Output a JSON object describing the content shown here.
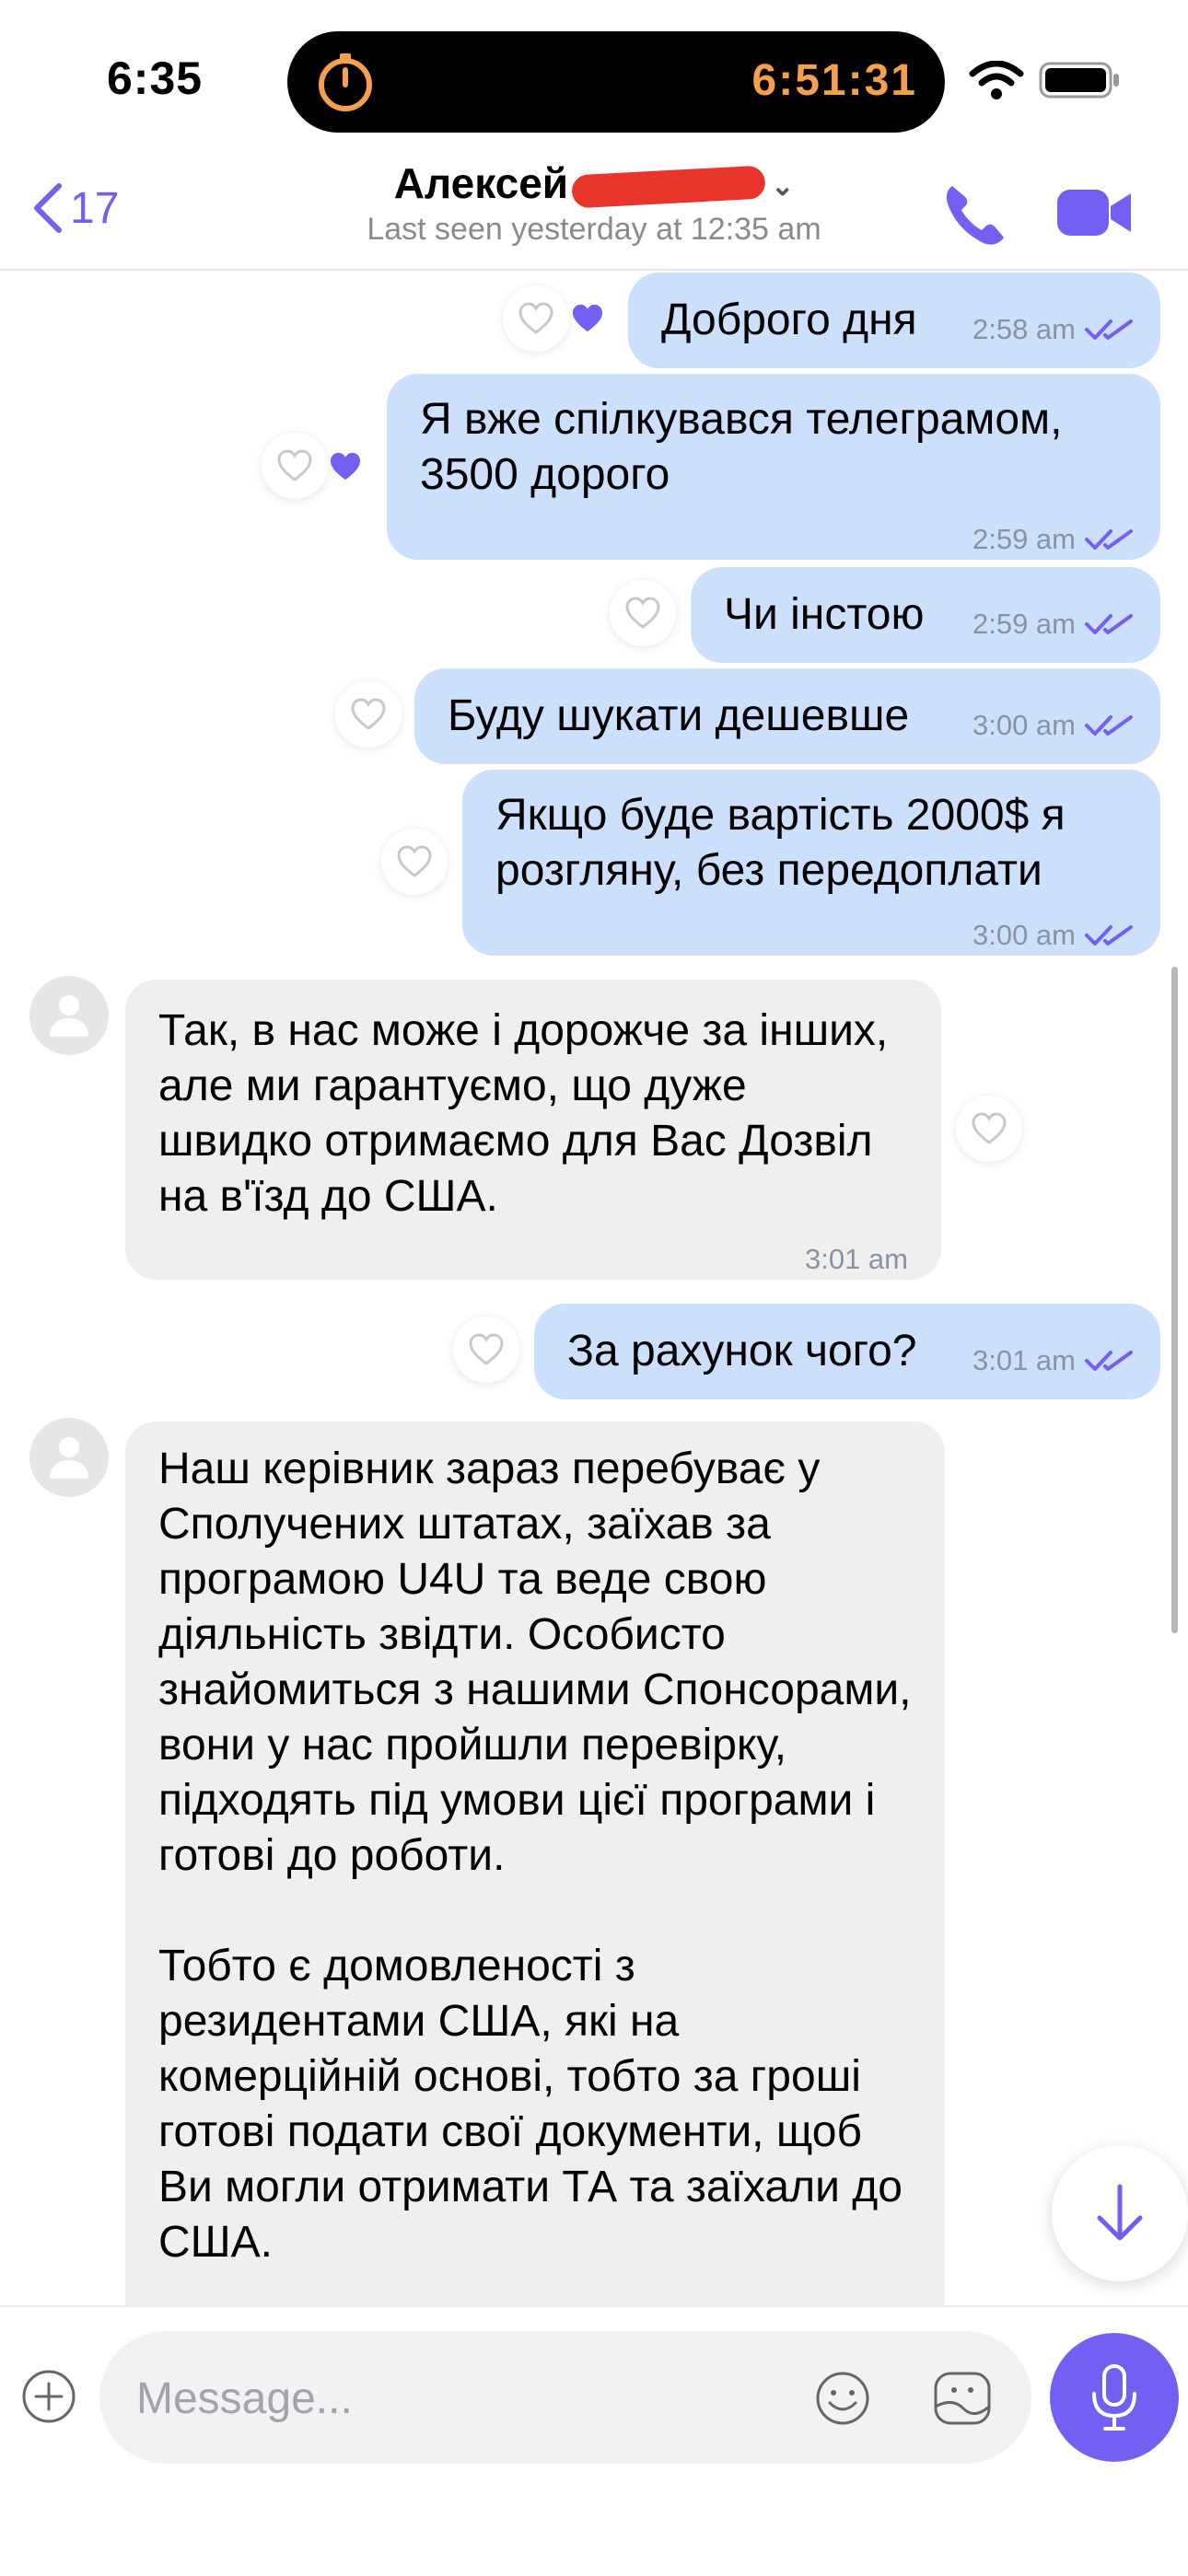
{
  "status_bar": {
    "time": "6:35",
    "timer": "6:51:31"
  },
  "header": {
    "back_count": "17",
    "contact_name": "Алексей",
    "last_seen": "Last seen yesterday at 12:35 am"
  },
  "colors": {
    "accent": "#7360F2",
    "outgoing_bubble": "#CCDFFB",
    "incoming_bubble": "#EFEFEF",
    "timer": "#F5A04A",
    "redaction": "#E8342B"
  },
  "messages": [
    {
      "direction": "out",
      "text": "Доброго дня",
      "time": "2:58 am"
    },
    {
      "direction": "out",
      "text": "Я вже спілкувався телеграмом, 3500 дорого",
      "time": "2:59 am"
    },
    {
      "direction": "out",
      "text": "Чи інстою",
      "time": "2:59 am"
    },
    {
      "direction": "out",
      "text": "Буду шукати дешевше",
      "time": "3:00 am"
    },
    {
      "direction": "out",
      "text": "Якщо буде вартість 2000$ я розгляну, без передоплати",
      "time": "3:00 am"
    },
    {
      "direction": "in",
      "text": "Так, в нас може і дорожче за інших, але ми гарантуємо, що дуже швидко отримаємо для Вас Дозвіл на в'їзд до США.",
      "time": "3:01 am"
    },
    {
      "direction": "out",
      "text": "За рахунок чого?",
      "time": "3:01 am"
    },
    {
      "direction": "in",
      "text": "Наш керівник зараз перебуває у Сполучених штатах, заїхав за програмою U4U та веде свою діяльність звідти. Особисто знайомиться з нашими Спонсорами, вони у нас пройшли перевірку, підходять під умови цієї програми і готові до роботи.",
      "text2": "Тобто є домовленості з резидентами США, які на комерційній основі, тобто за гроші готові подати свої документи, щоб Ви могли отримати ТА та заїхали до США.",
      "time": ""
    }
  ],
  "composer": {
    "placeholder": "Message..."
  }
}
